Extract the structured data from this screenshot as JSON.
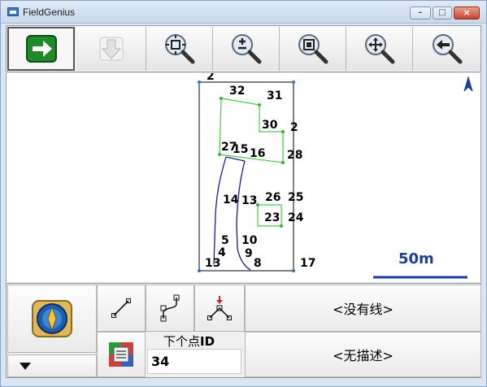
{
  "window": {
    "title": "FieldGenius"
  },
  "window_controls": {
    "minimize": "–",
    "maximize": "□",
    "close": "×"
  },
  "toolbar": {
    "buttons": [
      {
        "name": "next-arrow-button",
        "icon": "right-arrow-icon"
      },
      {
        "name": "download-button",
        "icon": "download-arrow-icon"
      },
      {
        "name": "zoom-extents-button",
        "icon": "zoom-extents-icon"
      },
      {
        "name": "zoom-in-out-button",
        "icon": "zoom-plus-minus-icon"
      },
      {
        "name": "zoom-window-button",
        "icon": "zoom-window-icon"
      },
      {
        "name": "pan-button",
        "icon": "pan-move-icon"
      },
      {
        "name": "zoom-previous-button",
        "icon": "zoom-back-icon"
      }
    ]
  },
  "map": {
    "north_marker": "north-arrow-icon",
    "scale_bar_label": "50m",
    "point_labels": [
      "2",
      "32",
      "31",
      "30",
      "2",
      "27",
      "15",
      "16",
      "28",
      "14",
      "13",
      "26",
      "25",
      "23",
      "24",
      "5",
      "10",
      "4",
      "9",
      "13",
      "8",
      "17"
    ],
    "colors": {
      "boundary": "#000000",
      "polyline_green": "#44cc44",
      "polyline_blue": "#1a1a8c",
      "scale": "#1a3e9a"
    }
  },
  "bottom_panel": {
    "line_status": "<没有线>",
    "description_status": "<无描述>",
    "next_point_label_prefix": "下个点",
    "next_point_label_suffix": "ID",
    "next_point_id": "34",
    "tools": [
      "line-tool-icon",
      "curve-connect-tool-icon",
      "arc-point-tool-icon"
    ]
  }
}
